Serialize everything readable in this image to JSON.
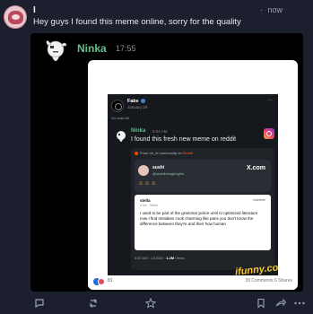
{
  "post": {
    "display_name": "I               ",
    "time": "now",
    "text": "Hey guys I found this meme online, sorry for the quality"
  },
  "media": {
    "author": "Ninka",
    "time": "17:55",
    "embed": {
      "fake_account": "Fake",
      "fake_date": "January 29",
      "fake_sub": "Go read bit",
      "inner_author": "Ninka",
      "inner_time": "5:04 AM",
      "inner_message": "I found this fresh new meme on reddit",
      "reddit_header_prefix": "From r/e_bt community on",
      "reddit_header_brand": "Reddit",
      "sushi_name": "sushi",
      "sushi_handle": "@sushibeingbrights",
      "xcom": "X.com",
      "faces": "☺☺☺",
      "stella_name": "stella",
      "stella_sub": "4 hrs · Stella",
      "stella_tag": "indefinite",
      "stella_text": "I used to be part of the grammar police until AI optimized literature now I find mistakes cook charming like pans you don't know the difference between they're and their how human",
      "stats_time": "4:57 AM · 1/13/26 ·",
      "stats_views": "1.2M",
      "stats_suffix": "Views",
      "watermark": "ifunny.co",
      "reaction_count": "81",
      "comment_count": "39 Comments  6 Shares"
    }
  },
  "actions": {
    "reply": "reply-icon",
    "boost": "boost-icon",
    "favourite": "star-icon",
    "bookmark": "bookmark-icon",
    "share": "share-icon",
    "more": "more-icon"
  }
}
